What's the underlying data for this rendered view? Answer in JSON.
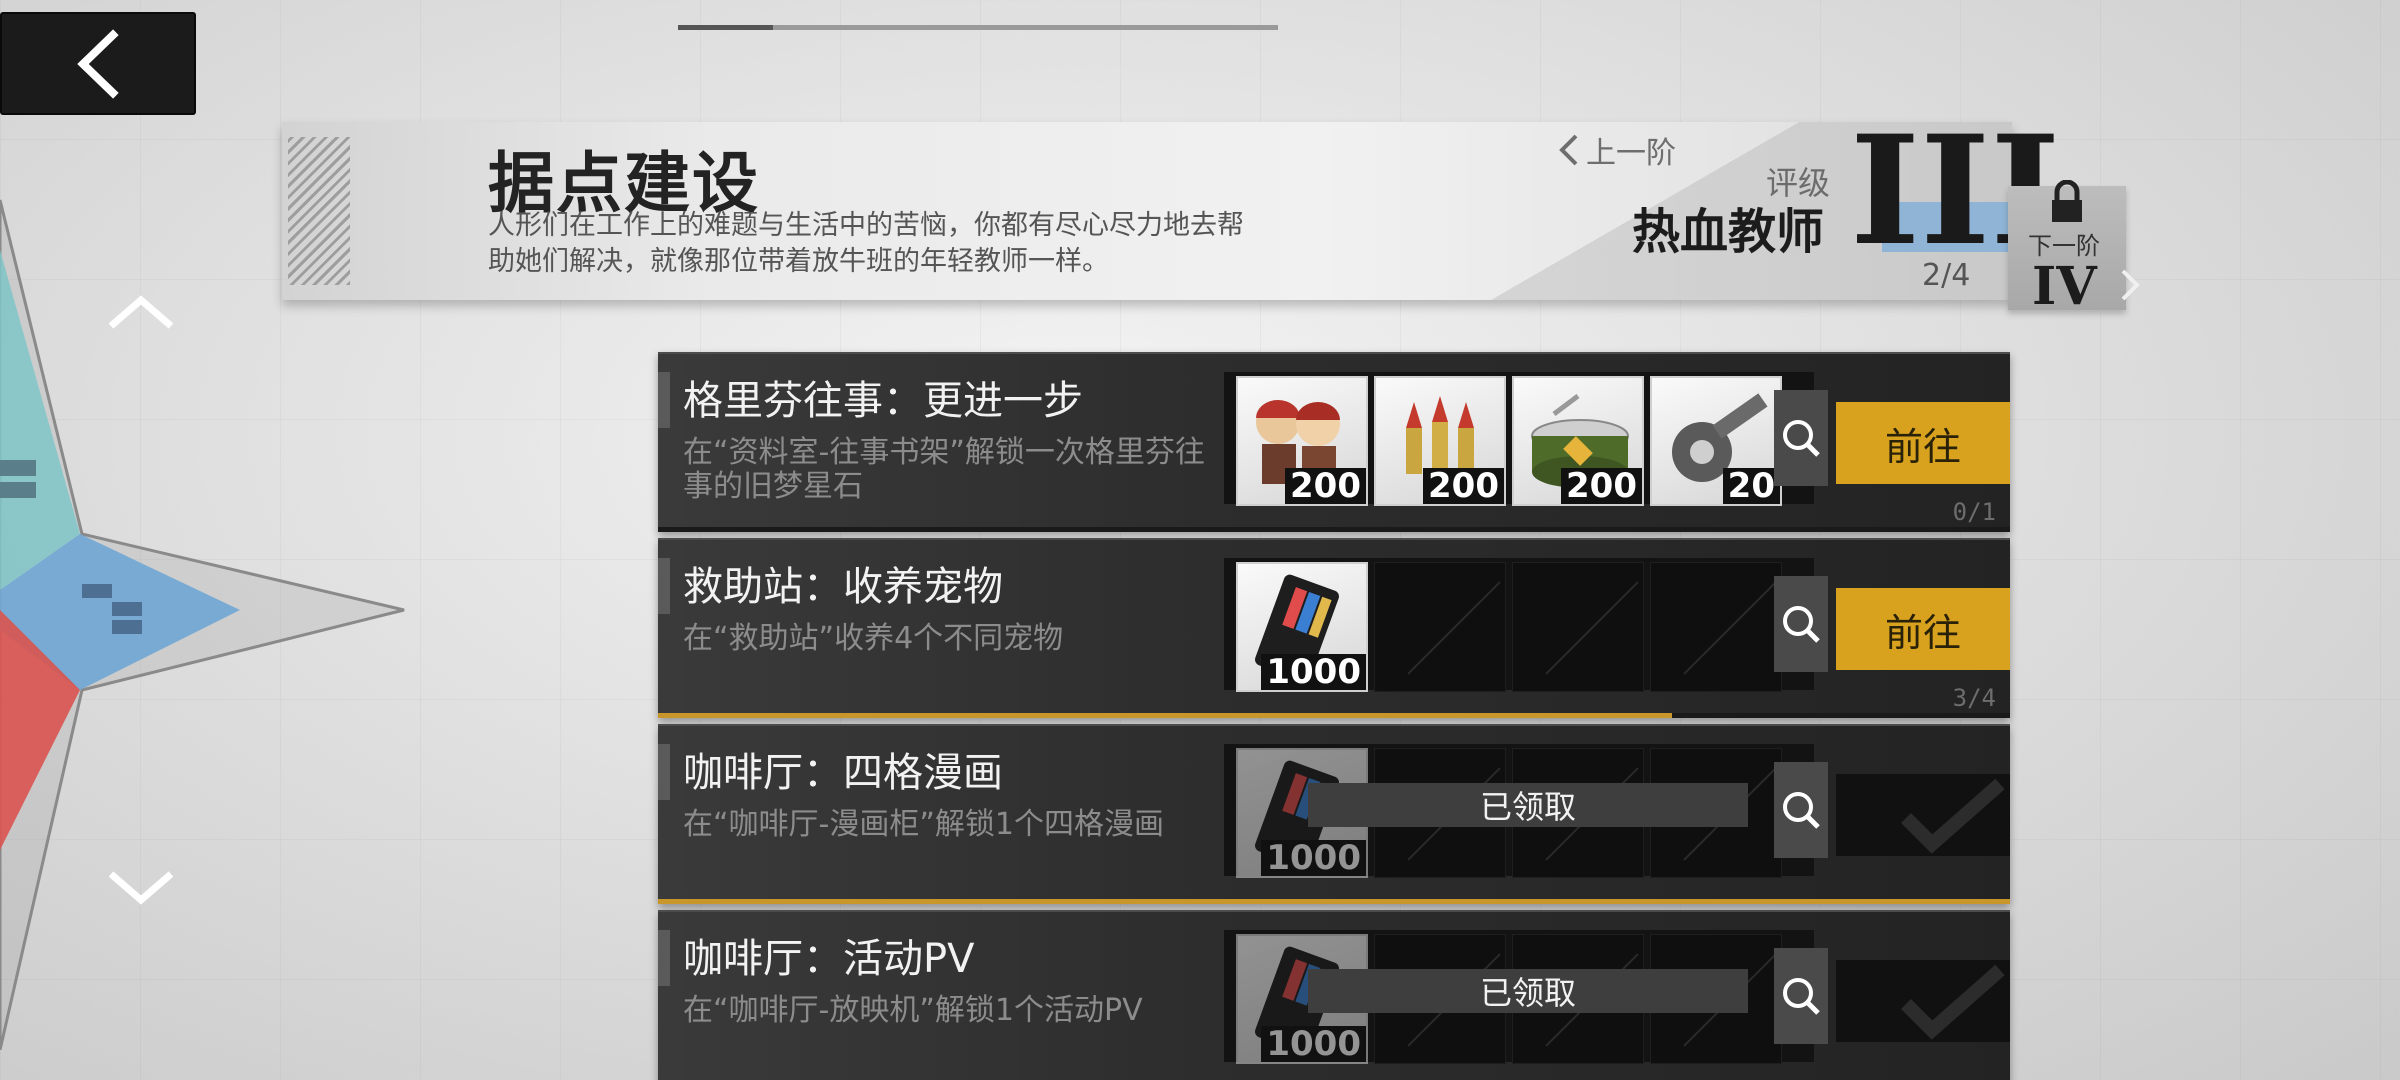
{
  "header": {
    "title": "据点建设",
    "description": "人形们在工作上的难题与生活中的苦恼，你都有尽心尽力地去帮助她们解决，就像那位带着放牛班的年轻教师一样。",
    "prev_tier_label": "上一阶",
    "rating_label": "评级",
    "rating_name": "热血教师",
    "rating_roman": "III",
    "rating_progress": "2/4",
    "next_tier_label": "下一阶",
    "next_tier_roman": "IV"
  },
  "tasks": [
    {
      "title": "格里芬往事：更进一步",
      "description": "在“资料室-往事书架”解锁一次格里芬往事的旧梦星石",
      "rewards": [
        {
          "icon": "chibi-dolls-icon",
          "qty": "200"
        },
        {
          "icon": "ammo-icon",
          "qty": "200"
        },
        {
          "icon": "ration-can-icon",
          "qty": "200"
        },
        {
          "icon": "parts-wrench-icon",
          "qty": "20"
        }
      ],
      "action_label": "前往",
      "status": "in-progress",
      "progress": "0/1",
      "progress_fraction": 0
    },
    {
      "title": "救助站：收养宠物",
      "description": "在“救助站”收养4个不同宠物",
      "rewards": [
        {
          "icon": "ticket-card-icon",
          "qty": "1000"
        }
      ],
      "action_label": "前往",
      "status": "in-progress",
      "progress": "3/4",
      "progress_fraction": 0.75
    },
    {
      "title": "咖啡厅：四格漫画",
      "description": "在“咖啡厅-漫画柜”解锁1个四格漫画",
      "rewards": [
        {
          "icon": "ticket-card-icon",
          "qty": "1000"
        }
      ],
      "claimed_label": "已领取",
      "status": "claimed",
      "progress_fraction": 1
    },
    {
      "title": "咖啡厅：活动PV",
      "description": "在“咖啡厅-放映机”解锁1个活动PV",
      "rewards": [
        {
          "icon": "ticket-card-icon",
          "qty": "1000"
        }
      ],
      "claimed_label": "已领取",
      "status": "claimed",
      "progress_fraction": 1
    }
  ],
  "colors": {
    "accent_gold": "#d8a21f",
    "rating_band": "#8fb4d6"
  }
}
